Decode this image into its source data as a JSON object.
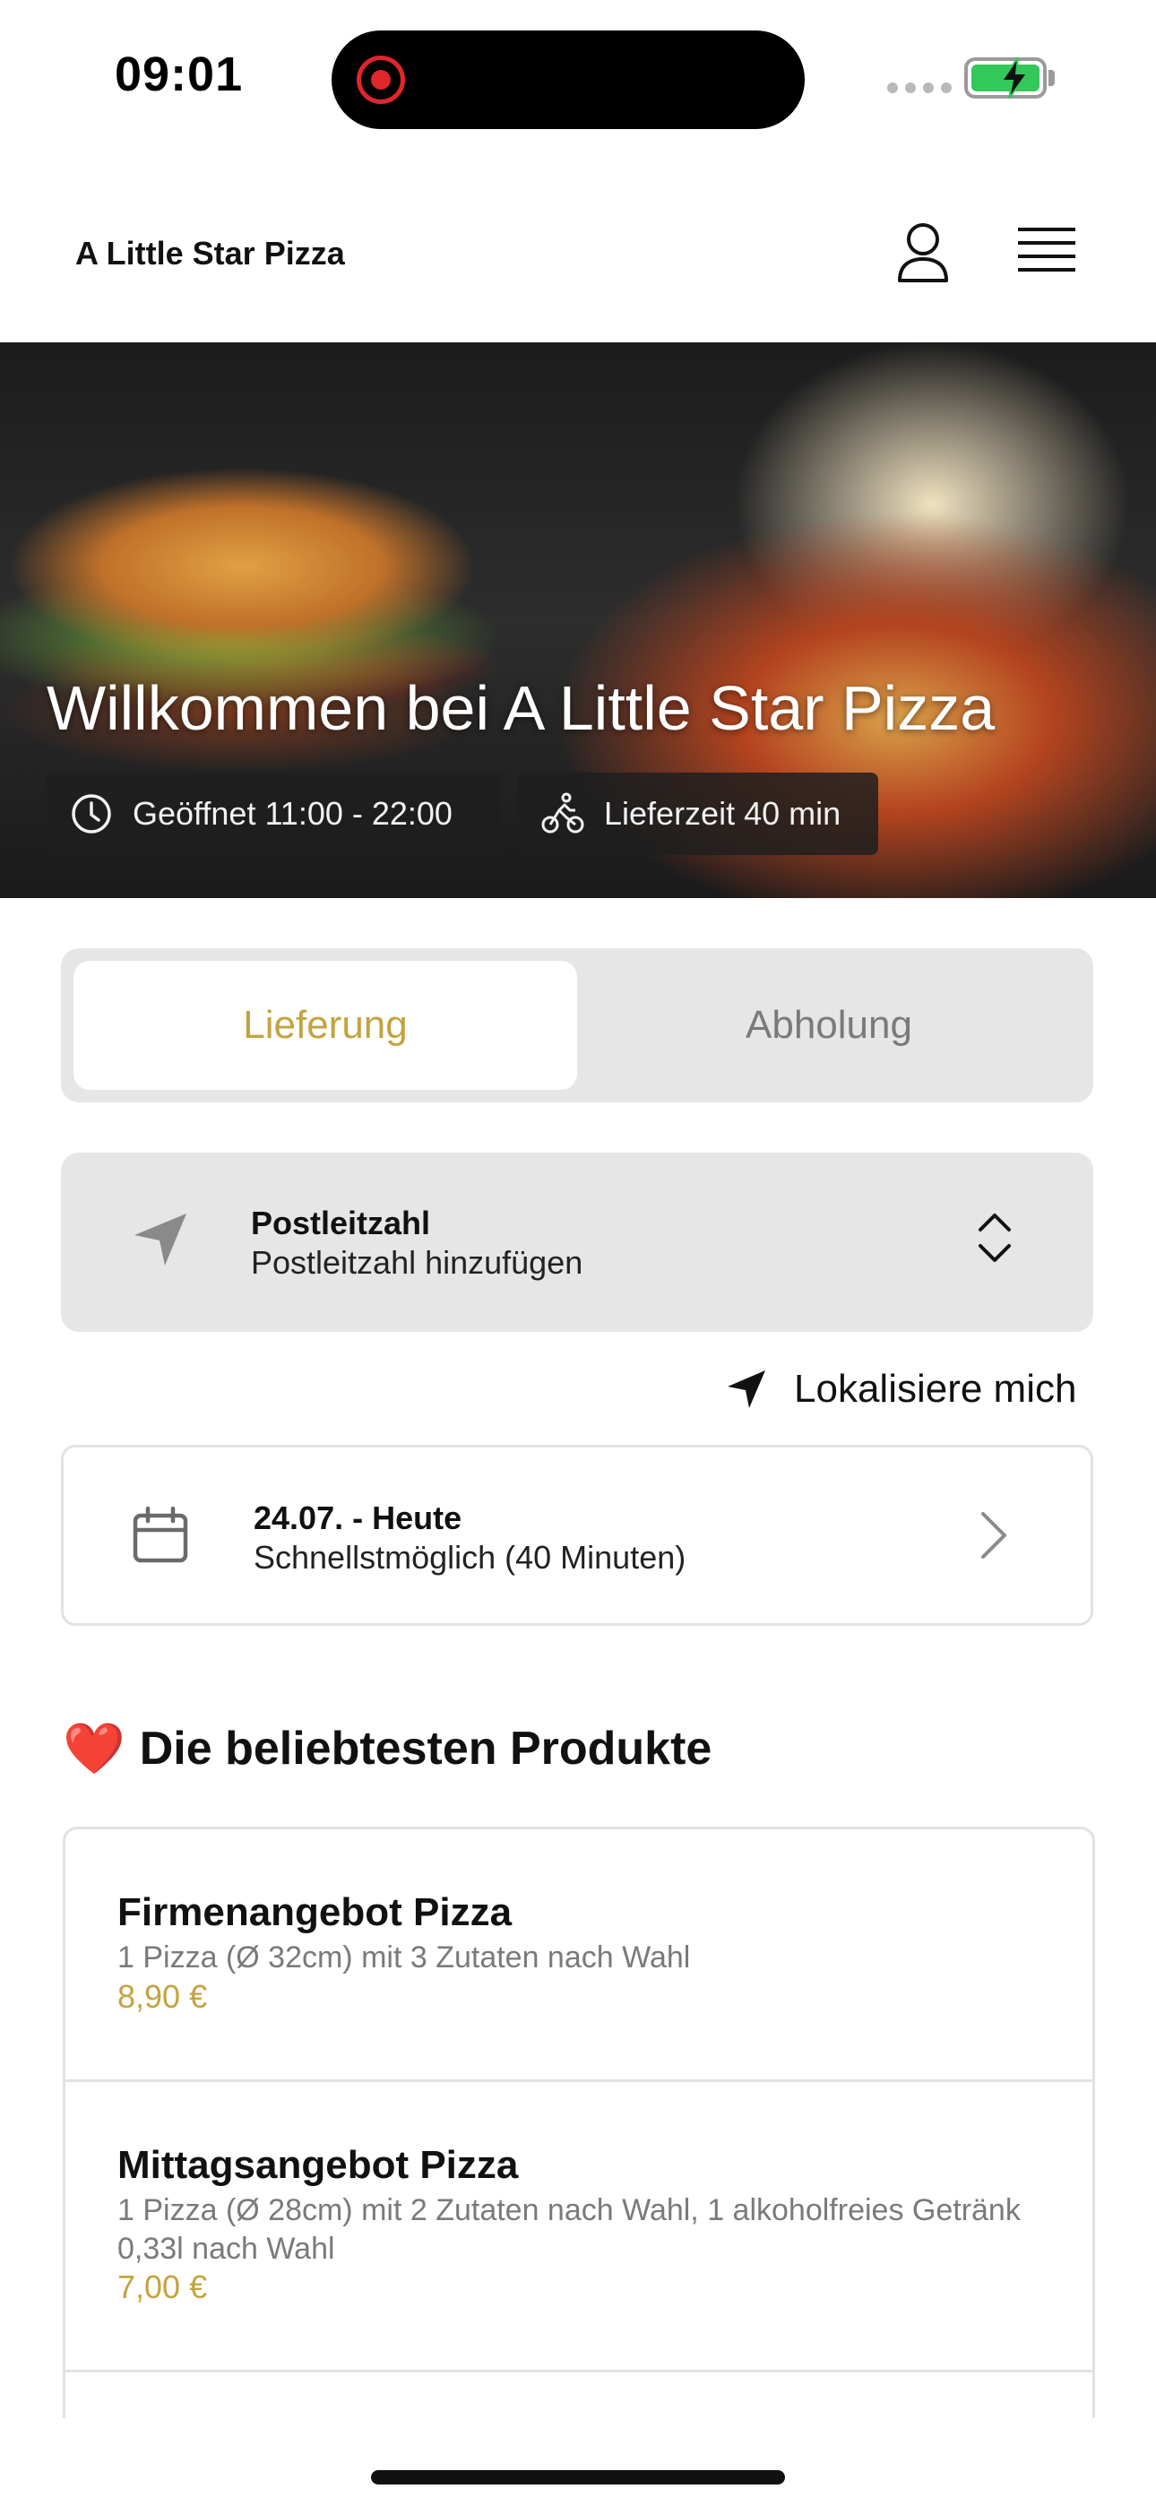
{
  "status_bar": {
    "time": "09:01"
  },
  "header": {
    "title": "A Little Star Pizza"
  },
  "hero": {
    "title": "Willkommen bei A Little Star Pizza",
    "opening_hours": "Geöffnet 11:00 - 22:00",
    "delivery_time": "Lieferzeit 40 min"
  },
  "order_mode": {
    "delivery_label": "Lieferung",
    "pickup_label": "Abholung",
    "selected": "Lieferung"
  },
  "postal": {
    "label": "Postleitzahl",
    "placeholder": "Postleitzahl hinzufügen"
  },
  "locate": {
    "label": "Lokalisiere mich"
  },
  "schedule": {
    "date": "24.07. - Heute",
    "time": "Schnellstmöglich (40 Minuten)"
  },
  "popular": {
    "heading": "Die beliebtesten Produkte",
    "emoji": "❤️",
    "items": [
      {
        "name": "Firmenangebot Pizza",
        "description": "1 Pizza (Ø 32cm) mit 3 Zutaten nach Wahl",
        "price": "8,90 €"
      },
      {
        "name": "Mittagsangebot Pizza",
        "description": "1 Pizza (Ø 28cm) mit 2 Zutaten nach Wahl, 1 alkoholfreies Getränk 0,33l nach Wahl",
        "price": "7,00 €"
      }
    ]
  },
  "colors": {
    "accent": "#c4a340",
    "panel": "#e6e6e6",
    "text": "#111111",
    "muted": "#7a7a7a",
    "hero_chip": "#1e1e1e"
  }
}
